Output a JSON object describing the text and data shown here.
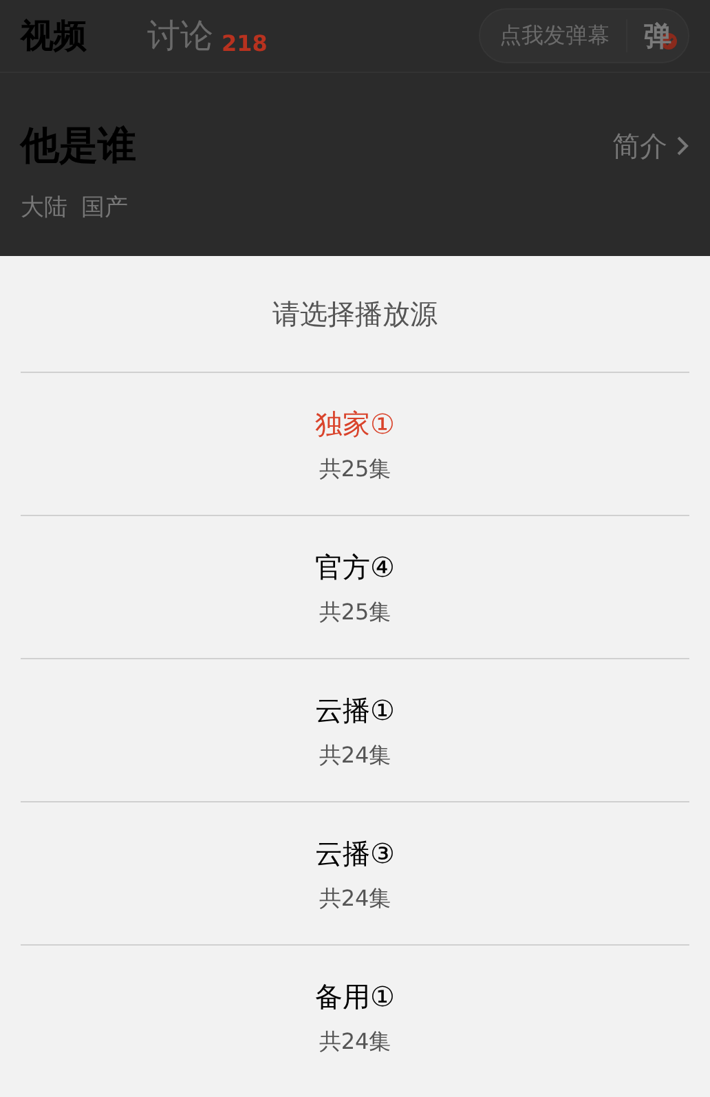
{
  "tabs": [
    {
      "label": "视频",
      "selected": true
    },
    {
      "label": "讨论",
      "selected": false,
      "count": "218"
    }
  ],
  "danmaku": {
    "placeholder": "点我发弹幕",
    "toggle": "弹"
  },
  "show": {
    "title": "他是谁",
    "intro_link": "简介",
    "tags": [
      "大陆",
      "国产"
    ]
  },
  "sheet": {
    "title": "请选择播放源",
    "sources": [
      {
        "name": "独家①",
        "episodes": "共25集",
        "selected": true
      },
      {
        "name": "官方④",
        "episodes": "共25集",
        "selected": false
      },
      {
        "name": "云播①",
        "episodes": "共24集",
        "selected": false
      },
      {
        "name": "云播③",
        "episodes": "共24集",
        "selected": false
      },
      {
        "name": "备用①",
        "episodes": "共24集",
        "selected": false
      }
    ]
  }
}
